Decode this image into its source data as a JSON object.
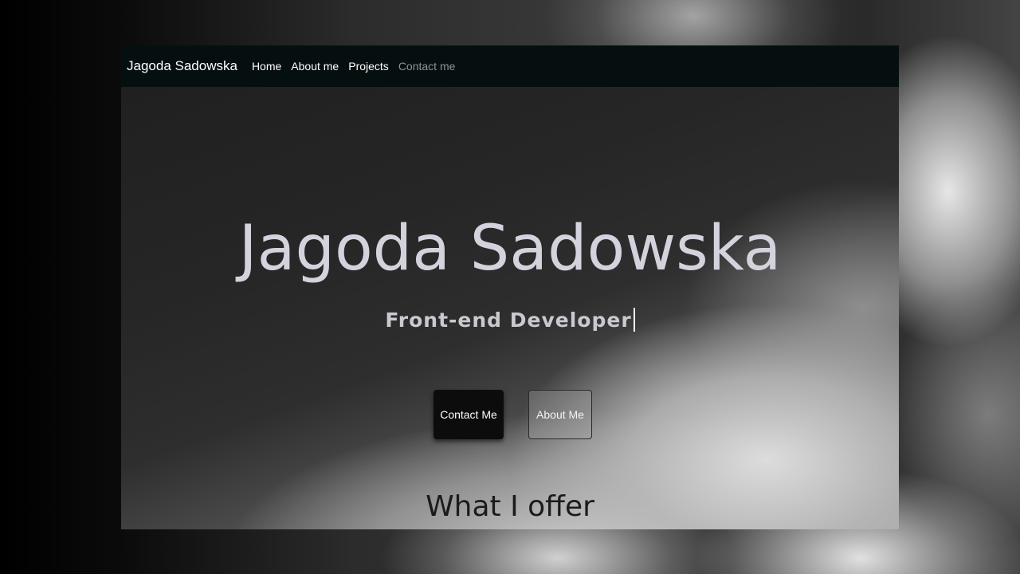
{
  "navbar": {
    "brand": "Jagoda Sadowska",
    "links": [
      {
        "label": "Home",
        "active": false
      },
      {
        "label": "About me",
        "active": false
      },
      {
        "label": "Projects",
        "active": false
      },
      {
        "label": "Contact me",
        "active": true
      }
    ]
  },
  "hero": {
    "title": "Jagoda Sadowska",
    "subtitle": "Front-end Developer",
    "buttons": {
      "contact": "Contact Me",
      "about": "About Me"
    }
  },
  "offer": {
    "heading": "What I offer"
  },
  "colors": {
    "navbar_bg": "#060f10",
    "title_text": "#d3d3de",
    "primary_button": "#0c0c0c"
  }
}
